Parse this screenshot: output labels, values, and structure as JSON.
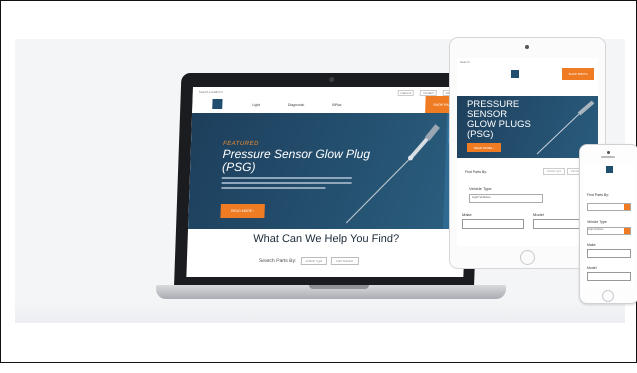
{
  "colors": {
    "accent": "#ef7b22",
    "brand_navy": "#1f4e6e",
    "hero": "#24506f"
  },
  "laptop": {
    "topbar": {
      "lang": "Search Location ▾",
      "links": [
        "Careers",
        "Contact",
        "Distributors"
      ]
    },
    "nav": [
      "Light",
      "Diagnostic",
      "BPlus"
    ],
    "shop_label": "SHOP PARTS",
    "hero": {
      "featured": "FEATURED",
      "title": "Pressure Sensor Glow Plug (PSG)",
      "button": "READ MORE ›"
    },
    "heading": "What Can We Help You Find?",
    "search_by": "Search Parts By:",
    "chips": [
      "Vehicle Type",
      "Part Number"
    ]
  },
  "tablet": {
    "header_text": "Search",
    "shop_label": "SHOP PARTS",
    "hero_title": "PRESSURE SENSOR GLOW PLUGS (PSG)",
    "read_more": "READ MORE ›",
    "find_label": "Find Parts By:",
    "tabs": [
      "Vehicle Type",
      "Part Number"
    ],
    "vehicle_type_label": "Vehicle Type",
    "vehicle_select": "Light Vehicles",
    "make_label": "Make",
    "model_label": "Model"
  },
  "phone": {
    "parts_label": "Find Parts By:",
    "vehicle_type_label": "Vehicle Type",
    "vehicle_select": "Light Vehicles",
    "make_label": "Make",
    "model_label": "Model"
  }
}
